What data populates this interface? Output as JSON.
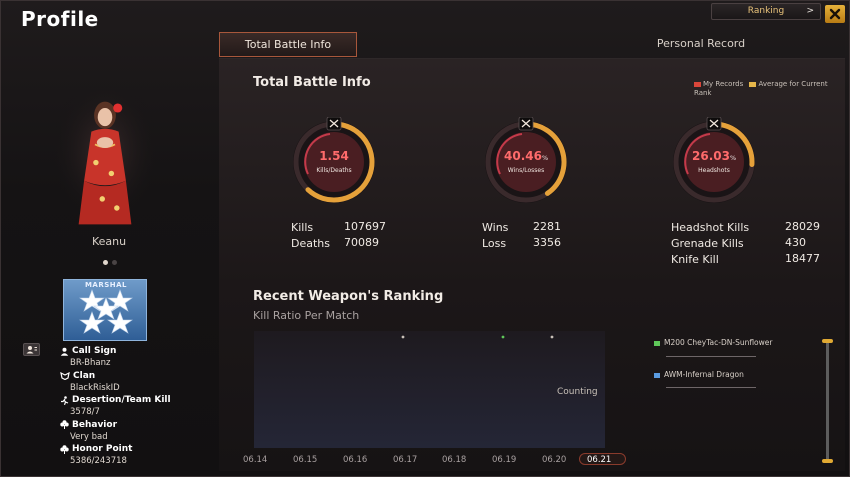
{
  "window": {
    "title": "Profile",
    "ranking_label": "Ranking",
    "ranking_arrow": ">",
    "close_icon": "close-icon"
  },
  "tabs": [
    {
      "label": "Total Battle Info",
      "active": true
    },
    {
      "label": "Personal Record",
      "active": false
    }
  ],
  "character": {
    "name": "Keanu",
    "page_dots": 2,
    "current_dot": 0
  },
  "rank_badge": {
    "label": "MARSHAL",
    "stars": 5
  },
  "profile_info": [
    {
      "icon": "person-icon",
      "label": "Call Sign",
      "value": "BR-Bhanz"
    },
    {
      "icon": "clan-icon",
      "label": "Clan",
      "value": "BlackRiskID"
    },
    {
      "icon": "runner-icon",
      "label": "Desertion/Team Kill",
      "value": "3578/7"
    },
    {
      "icon": "clover-icon",
      "label": "Behavior",
      "value": "Very bad"
    },
    {
      "icon": "clover-icon",
      "label": "Honor Point",
      "value": "5386/243718"
    }
  ],
  "battle_info": {
    "title": "Total Battle Info",
    "legend": {
      "my_records": "My Records",
      "average": "Average for Current Rank",
      "my_color": "#d9463a",
      "avg_color": "#e5b64a"
    },
    "gauges": [
      {
        "value": "1.54",
        "unit": "",
        "label": "Kills/Deaths",
        "icon": "skull-crossbones-icon",
        "fill": 0.62
      },
      {
        "value": "40.46",
        "unit": "%",
        "label": "Wins/Losses",
        "icon": "crossed-swords-icon",
        "fill": 0.4046
      },
      {
        "value": "26.03",
        "unit": "%",
        "label": "Headshots",
        "icon": "crosshair-knife-icon",
        "fill": 0.2603
      }
    ],
    "stats_kd": [
      {
        "label": "Kills",
        "value": "107697"
      },
      {
        "label": "Deaths",
        "value": "70089"
      }
    ],
    "stats_wl": [
      {
        "label": "Wins",
        "value": "2281"
      },
      {
        "label": "Loss",
        "value": "3356"
      }
    ],
    "stats_hs": [
      {
        "label": "Headshot Kills",
        "value": "28029"
      },
      {
        "label": "Grenade Kills",
        "value": "430"
      },
      {
        "label": "Knife Kill",
        "value": "18477"
      }
    ]
  },
  "weapon_ranking": {
    "title": "Recent Weapon's Ranking",
    "subtitle": "Kill Ratio Per Match",
    "status": "Counting",
    "dates": [
      "06.14",
      "06.15",
      "06.16",
      "06.17",
      "06.18",
      "06.19",
      "06.20",
      "06.21"
    ],
    "current_date": "06.21",
    "weapons": [
      {
        "name": "M200 CheyTac-DN-Sunflower",
        "color": "#5fc85a"
      },
      {
        "name": "AWM-Infernal Dragon",
        "color": "#5a9be0"
      }
    ]
  }
}
